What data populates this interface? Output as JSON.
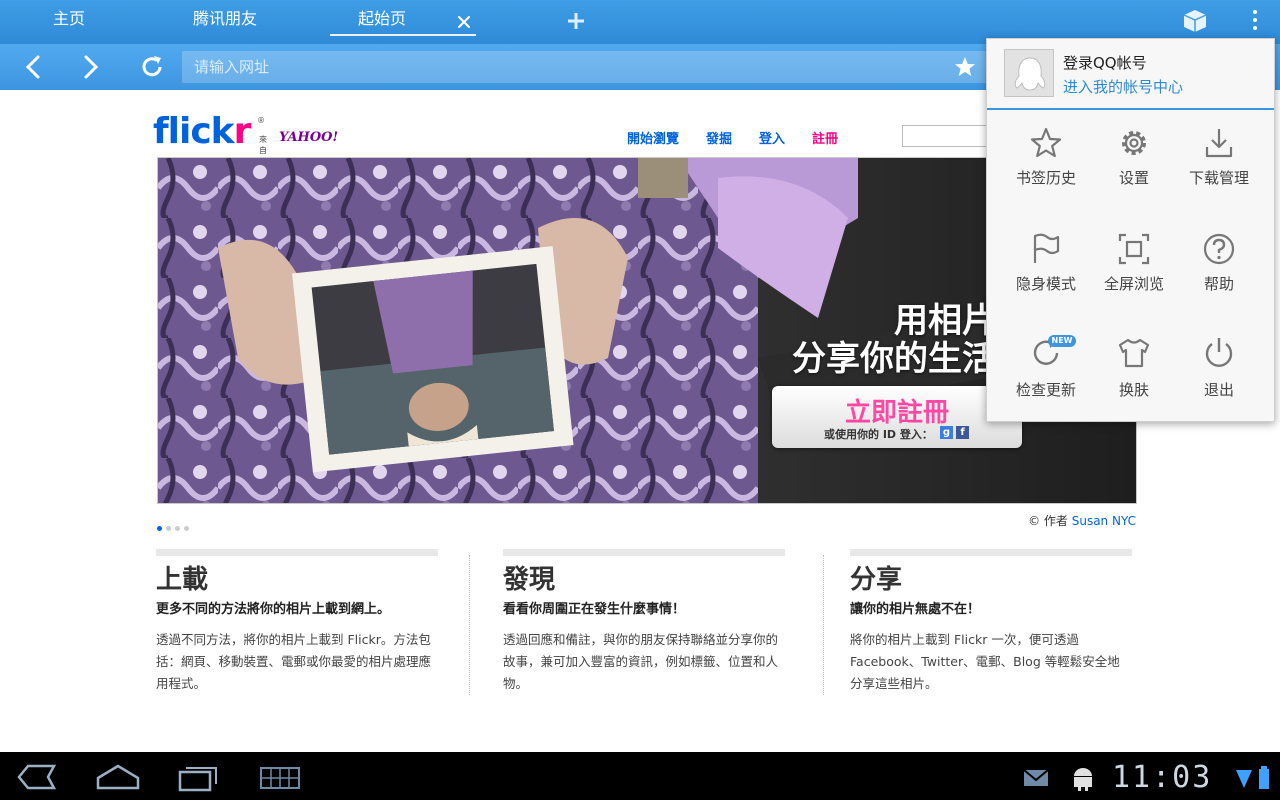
{
  "tabs": [
    {
      "label": "主页",
      "active": false
    },
    {
      "label": "腾讯朋友",
      "active": false
    },
    {
      "label": "起始页",
      "active": true
    }
  ],
  "toolbar": {
    "close_tab_icon": "close-icon",
    "new_tab_icon": "plus-icon",
    "cube_icon": "cube-icon",
    "overflow_icon": "overflow-menu-icon",
    "back_icon": "chevron-left-icon",
    "forward_icon": "chevron-right-icon",
    "reload_icon": "reload-icon",
    "bookmark_icon": "star-icon"
  },
  "address_bar": {
    "placeholder": "请输入网址",
    "value": ""
  },
  "page": {
    "logo_text_blue": "flick",
    "logo_text_pink": "r",
    "logo_reg": "®",
    "logo_from": "來自",
    "logo_yahoo": "YAHOO!",
    "nav": [
      "開始瀏覽",
      "發掘",
      "登入",
      "註冊"
    ],
    "hero": {
      "line1": "用相片",
      "line2": "分享你的生活",
      "cta": "立即註冊",
      "cta_sub": "或使用你的 ID 登入：",
      "cta_google": "g",
      "cta_facebook": "f"
    },
    "credit_prefix": "© 作者 ",
    "credit_author": "Susan NYC",
    "columns": [
      {
        "title": "上載",
        "subtitle": "更多不同的方法將你的相片上載到網上。",
        "body": "透過不同方法，將你的相片上載到 Flickr。方法包括：網頁、移動裝置、電郵或你最愛的相片處理應用程式。"
      },
      {
        "title": "發現",
        "subtitle": "看看你周圍正在發生什麼事情！",
        "body": "透過回應和備註，與你的朋友保持聯絡並分享你的故事，兼可加入豐富的資訊，例如標籤、位置和人物。"
      },
      {
        "title": "分享",
        "subtitle": "讓你的相片無處不在！",
        "body": "將你的相片上載到 Flickr 一次，便可透過 Facebook、Twitter、電郵、Blog 等輕鬆安全地分享這些相片。"
      }
    ]
  },
  "menu": {
    "account_title": "登录QQ帐号",
    "account_link": "进入我的帐号中心",
    "new_badge": "NEW",
    "items": [
      {
        "label": "书签历史",
        "icon": "star-icon"
      },
      {
        "label": "设置",
        "icon": "gear-icon"
      },
      {
        "label": "下载管理",
        "icon": "download-icon"
      },
      {
        "label": "隐身模式",
        "icon": "incognito-flag-icon"
      },
      {
        "label": "全屏浏览",
        "icon": "fullscreen-icon"
      },
      {
        "label": "帮助",
        "icon": "help-icon"
      },
      {
        "label": "检查更新",
        "icon": "refresh-icon"
      },
      {
        "label": "换肤",
        "icon": "shirt-icon"
      },
      {
        "label": "退出",
        "icon": "power-icon"
      }
    ]
  },
  "system_bar": {
    "time": "11:03",
    "icons": [
      "back-icon",
      "home-icon",
      "recent-apps-icon",
      "keyboard-icon",
      "gmail-icon",
      "android-debug-icon",
      "wifi-icon",
      "battery-icon"
    ]
  },
  "colors": {
    "tab_bar": "#3f9ee6",
    "flickr_blue": "#0063dc",
    "flickr_pink": "#ff0084",
    "menu_accent": "#3d95e0"
  }
}
